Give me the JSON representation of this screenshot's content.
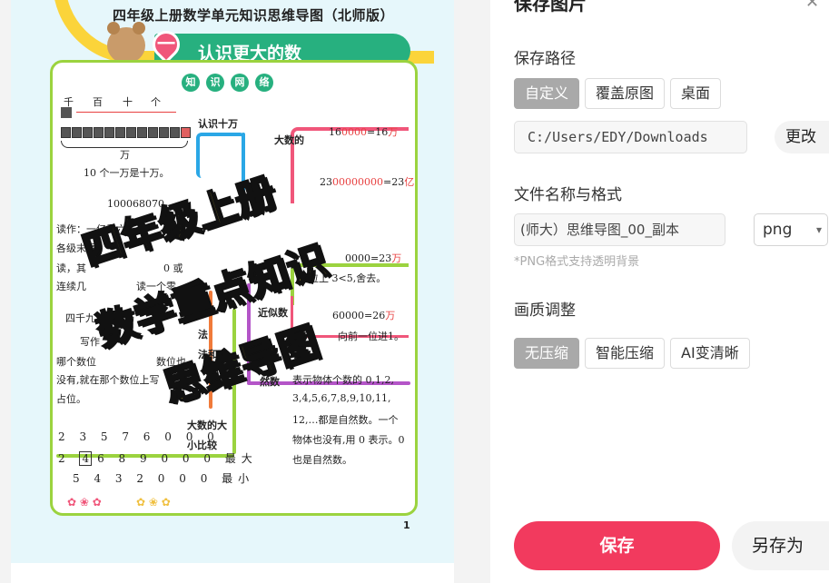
{
  "preview": {
    "doc_title": "四年级上册数学单元知识思维导图（北师版）",
    "unit_number": "一",
    "unit_title": "认识更大的数",
    "network_chars": [
      "知",
      "识",
      "网",
      "络"
    ],
    "place_labels": [
      "千",
      "百",
      "十",
      "个"
    ],
    "wan_label": "万",
    "ten_thousand_note": "10 个一万是十万。",
    "branch_recognize": "认识十万",
    "branch_large": "大数的",
    "eq1_left": "16",
    "eq1_red": "0000",
    "eq1_right": "=16",
    "eq1_unit": "万",
    "eq2_left": "23",
    "eq2_red": "00000000",
    "eq2_right": "=23",
    "eq2_unit": "亿",
    "number_example": "100068070",
    "read_line1": "读作：一亿零六万",
    "read_line2": "各级末尾",
    "read_line3": "读，其",
    "read_line4": "连续几",
    "read_r3": "0 或",
    "read_r4": "读一个零",
    "eq3": "0000=23",
    "eq3_unit": "万",
    "approx_label": "近似数",
    "approx_right": "60000=26",
    "approx_unit": "万",
    "rule_small": "位上 3<5,舍去。",
    "rule_carry": "向前一位进1。",
    "write_line1": "四千九百零七万",
    "write_line2": "写作",
    "place_note1": "哪个数位",
    "place_note1r": "数位也",
    "place_note2": "没有,就在那个数位上写",
    "place_note3": "占位。",
    "law_label": "法",
    "law_label2": "法和",
    "natural_label": "然数",
    "natural_text1": "表示物体个数的 0,1,2,",
    "natural_text2": "3,4,5,6,7,8,9,10,11,",
    "natural_text3": "12,…都是自然数。一个",
    "natural_text4": "物体也没有,用 0 表示。0",
    "natural_text5": "也是自然数。",
    "compare_label1": "大数的大",
    "compare_label2": "小比较",
    "digit_row1": "2 3 5 7 6 0 0 0",
    "digit_row2_box": "4",
    "digit_row2_pre": "2",
    "digit_row2_rest": "6 8 9 0 0 0 最大",
    "digit_row3": "5 4 3 2 0 0 0 最小",
    "recog_label": "认识",
    "page_number": "1",
    "overlay_line1": "四年级上册",
    "overlay_line2": "数学重点知识",
    "overlay_line3": "思维导图"
  },
  "panel": {
    "title": "保存图片",
    "path_label": "保存路径",
    "path_options": [
      "自定义",
      "覆盖原图",
      "桌面"
    ],
    "path_selected": "自定义",
    "path_value": "C:/Users/EDY/Downloads",
    "change_label": "更改",
    "filename_label": "文件名称与格式",
    "filename_value": "(师大）思维导图_00_副本",
    "format_value": "png",
    "format_hint": "*PNG格式支持透明背景",
    "quality_label": "画质调整",
    "quality_options": [
      "无压缩",
      "智能压缩",
      "AI变清晰"
    ],
    "quality_selected": "无压缩",
    "save_label": "保存",
    "saveas_label": "另存为"
  }
}
